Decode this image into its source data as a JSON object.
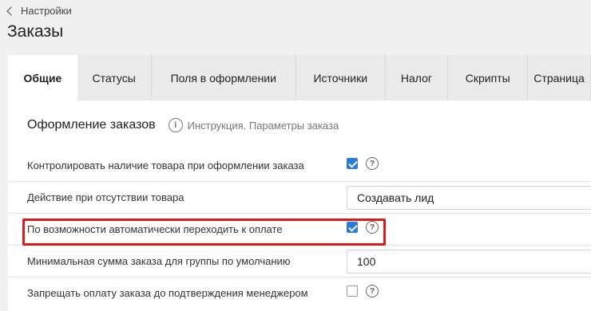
{
  "header": {
    "back_label": "Настройки",
    "title": "Заказы"
  },
  "tabs": [
    {
      "label": "Общие",
      "active": true
    },
    {
      "label": "Статусы",
      "active": false
    },
    {
      "label": "Поля в оформлении",
      "active": false
    },
    {
      "label": "Источники",
      "active": false
    },
    {
      "label": "Налог",
      "active": false
    },
    {
      "label": "Скрипты",
      "active": false
    },
    {
      "label": "Страница",
      "active": false
    }
  ],
  "section": {
    "title": "Оформление заказов",
    "info_link": "Инструкция. Параметры заказа"
  },
  "settings": [
    {
      "label": "Контролировать наличие товара при оформлении заказа",
      "type": "checkbox",
      "checked": true
    },
    {
      "label": "Действие при отсутствии товара",
      "type": "select",
      "value": "Создавать лид"
    },
    {
      "label": "По возможности автоматически переходить к оплате",
      "type": "checkbox",
      "checked": true,
      "highlighted": true
    },
    {
      "label": "Минимальная сумма заказа для группы по умолчанию",
      "type": "input",
      "value": "100"
    },
    {
      "label": "Запрещать оплату заказа до подтверждения менеджером",
      "type": "checkbox",
      "checked": false
    }
  ],
  "colors": {
    "accent": "#2d7bd6",
    "highlight": "#d91b1b"
  }
}
